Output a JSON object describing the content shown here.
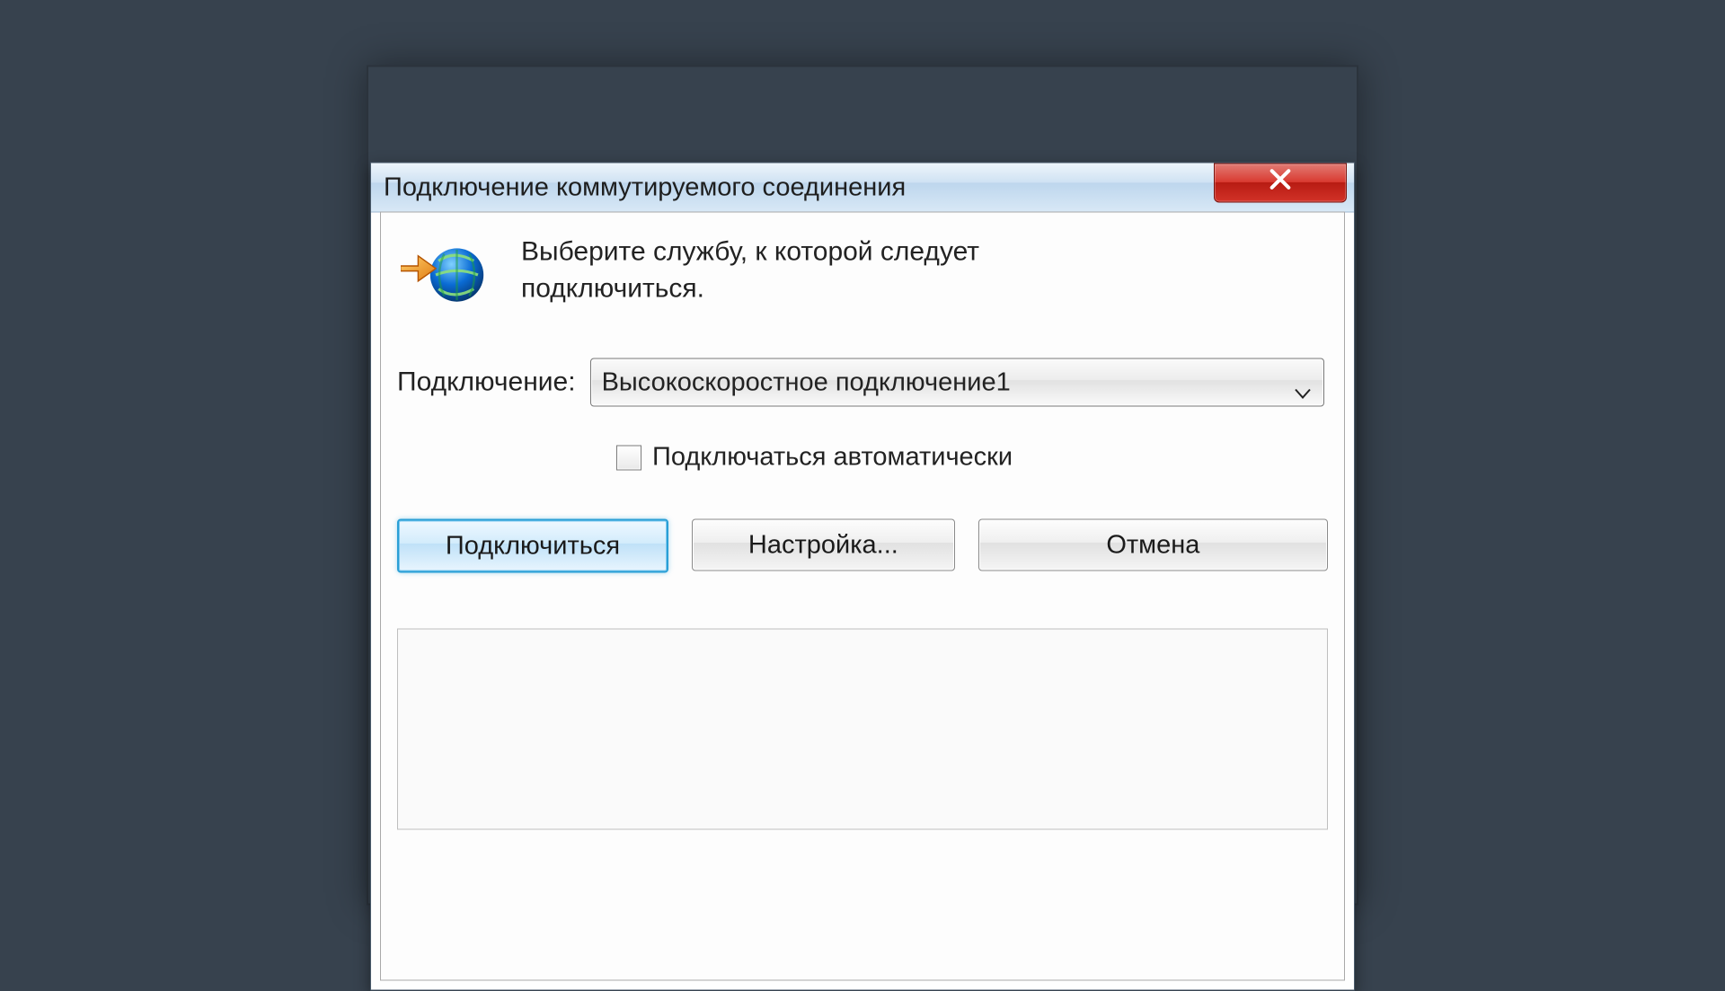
{
  "title": "Подключение коммутируемого соединения",
  "intro": "Выберите службу, к которой следует подключиться.",
  "connection_label": "Подключение:",
  "connection_value": "Высокоскоростное подключение1",
  "auto_connect_label": "Подключаться автоматически",
  "auto_connect_checked": false,
  "buttons": {
    "connect": "Подключиться",
    "settings": "Настройка...",
    "cancel": "Отмена"
  },
  "colors": {
    "desktop_bg": "#37424e",
    "close_red": "#c8281f",
    "focus_blue": "#2a9fd6"
  }
}
